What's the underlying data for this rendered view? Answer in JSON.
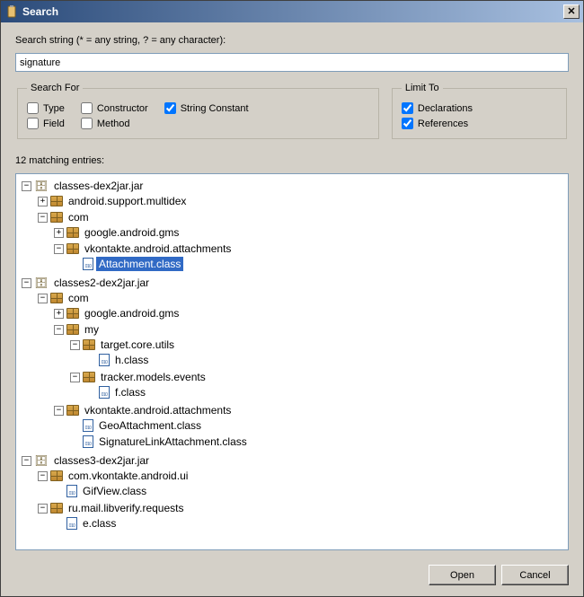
{
  "titlebar": {
    "title": "Search"
  },
  "labels": {
    "search_string": "Search string (* = any string, ? = any character):",
    "search_for": "Search For",
    "limit_to": "Limit To",
    "type": "Type",
    "constructor": "Constructor",
    "string_constant": "String Constant",
    "field": "Field",
    "method": "Method",
    "declarations": "Declarations",
    "references": "References",
    "matches": "12 matching entries:"
  },
  "input": {
    "value": "signature"
  },
  "checkboxes": {
    "type": false,
    "constructor": false,
    "string_constant": true,
    "field": false,
    "method": false,
    "declarations": true,
    "references": true
  },
  "buttons": {
    "open": "Open",
    "cancel": "Cancel"
  },
  "tree": {
    "jar1": "classes-dex2jar.jar",
    "jar1_pkg_multidex": "android.support.multidex",
    "jar1_com": "com",
    "jar1_gms": "google.android.gms",
    "jar1_vk": "vkontakte.android.attachments",
    "jar1_vk_attach": "Attachment.class",
    "jar2": "classes2-dex2jar.jar",
    "jar2_com": "com",
    "jar2_gms": "google.android.gms",
    "jar2_my": "my",
    "jar2_target": "target.core.utils",
    "jar2_h": "h.class",
    "jar2_tracker": "tracker.models.events",
    "jar2_f": "f.class",
    "jar2_vk": "vkontakte.android.attachments",
    "jar2_geo": "GeoAttachment.class",
    "jar2_sig": "SignatureLinkAttachment.class",
    "jar3": "classes3-dex2jar.jar",
    "jar3_vkui": "com.vkontakte.android.ui",
    "jar3_gif": "GifView.class",
    "jar3_rumail": "ru.mail.libverify.requests",
    "jar3_e": "e.class"
  }
}
